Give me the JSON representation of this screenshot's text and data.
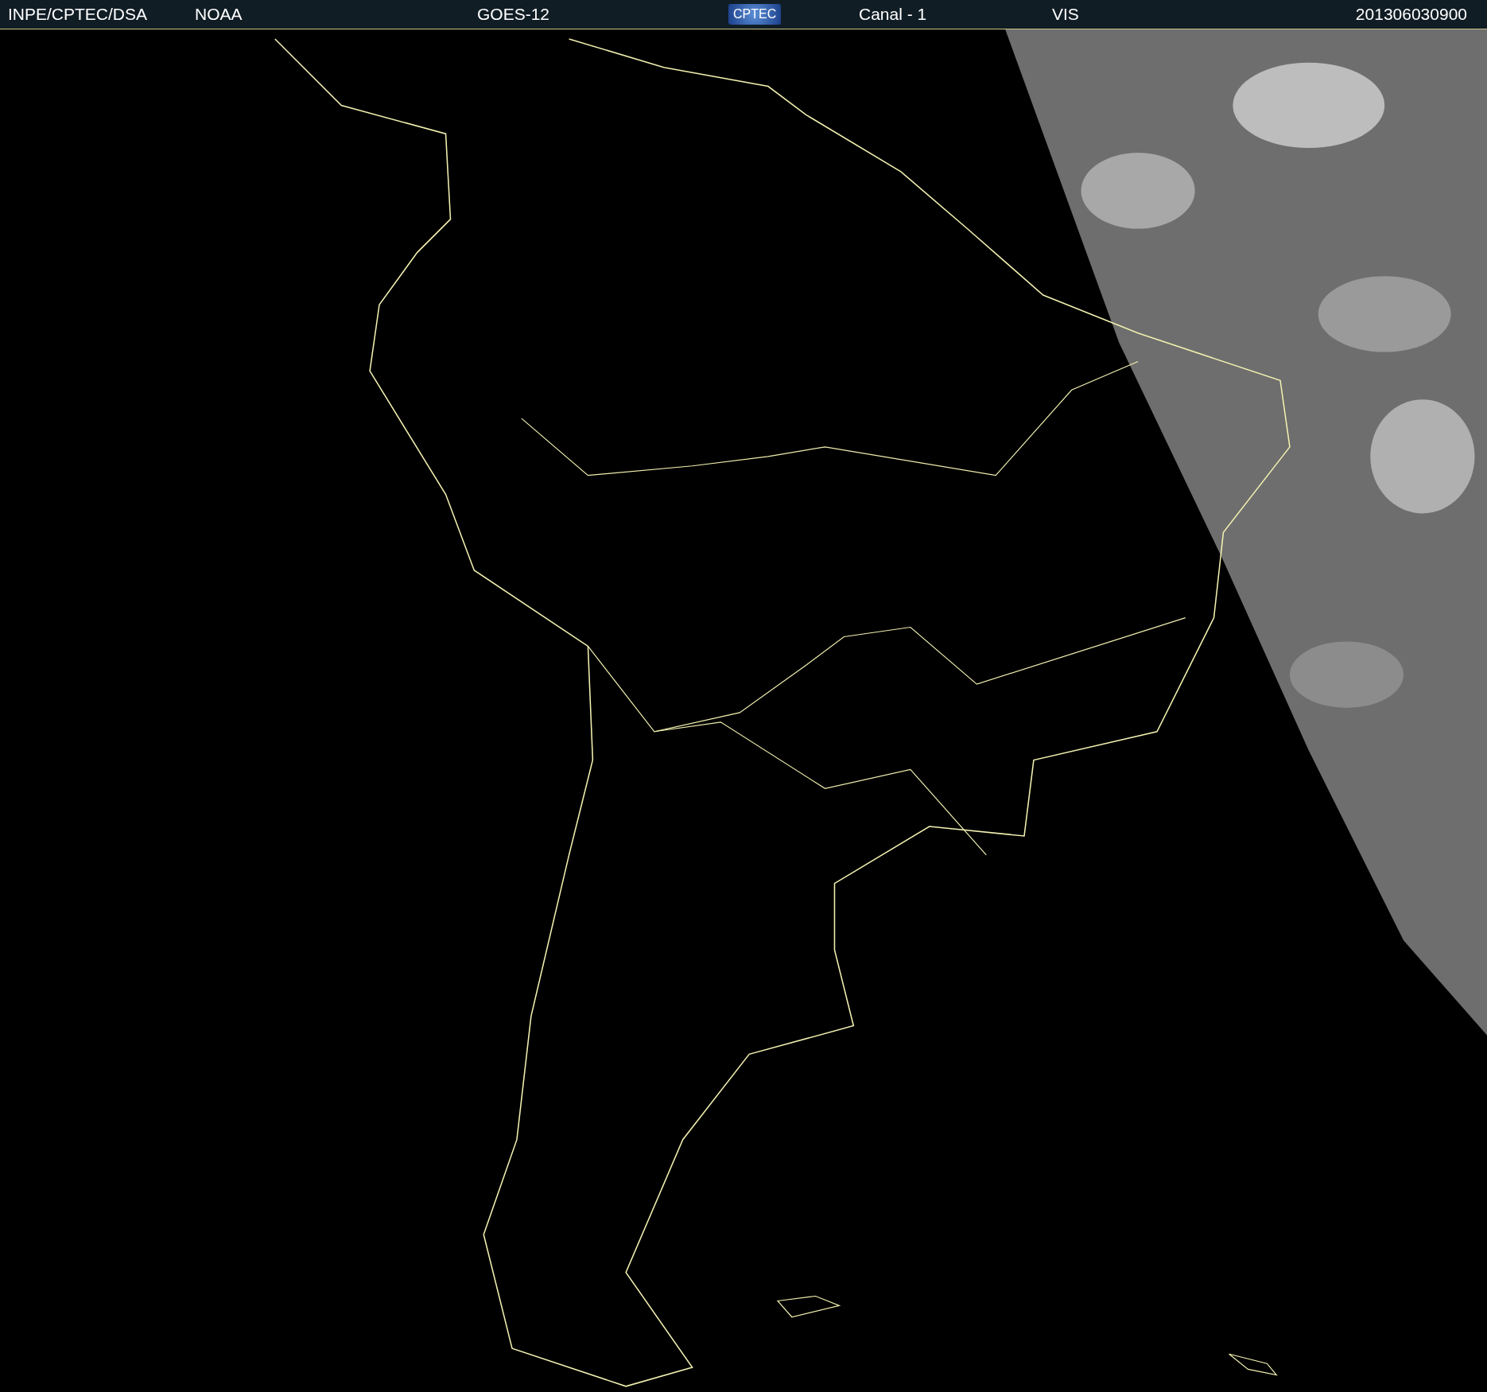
{
  "header": {
    "items": [
      {
        "kind": "text",
        "text": "INPE/CPTEC/DSA"
      },
      {
        "kind": "text",
        "text": "NOAA"
      },
      {
        "kind": "text",
        "text": "GOES-12"
      },
      {
        "kind": "logo",
        "text": "CPTEC"
      },
      {
        "kind": "text",
        "text": "Canal - 1"
      },
      {
        "kind": "text",
        "text": "VIS"
      },
      {
        "kind": "text",
        "text": "201306030900"
      }
    ]
  }
}
